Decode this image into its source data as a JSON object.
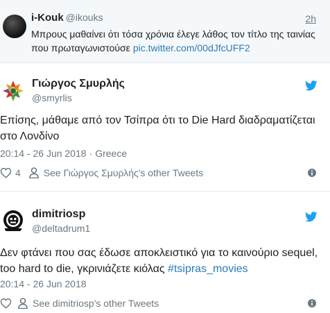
{
  "quoted": {
    "name": "i-Kouk",
    "handle": "@ikouks",
    "time": "2h",
    "text": "Μπρους μαθαίνει ότι τόσα χρόνια έλεγε λάθος τον τίτλο της ταινίας που πρωταγωνιστούσε ",
    "link": "pic.twitter.com/00dJfcUFF2"
  },
  "tweets": [
    {
      "name": "Γιώργος Σμυρλής",
      "handle": "@smyrlis",
      "text": "Επίσης, μάθαμε από τον Τσίπρα ότι το Die Hard διαδραματίζεται στο Λονδίνο",
      "time": "20:14 - 26 Jun 2018",
      "location": "Greece",
      "likes": "4",
      "other_tweets": "See Γιώργος Σμυρλής's other Tweets"
    },
    {
      "name": "dimitriosp",
      "handle": "@deltadrum1",
      "text": "Δεν φτάνει που σας έδωσε αποκλειστικό για το καινούριο sequel, too hard to die, γκρινιάζετε κιόλας ",
      "hashtag": "#tsipras_movies",
      "time": "20:14 - 26 Jun 2018",
      "other_tweets": "See dimitriosp's other Tweets"
    }
  ],
  "colors": {
    "twitter_blue": "#1da1f2",
    "link_blue": "#2b7bb9",
    "meta_gray": "#697882",
    "quote_bg": "#f5f8fa"
  },
  "icons": [
    "twitter-bird-icon",
    "heart-icon",
    "person-icon",
    "info-icon"
  ]
}
